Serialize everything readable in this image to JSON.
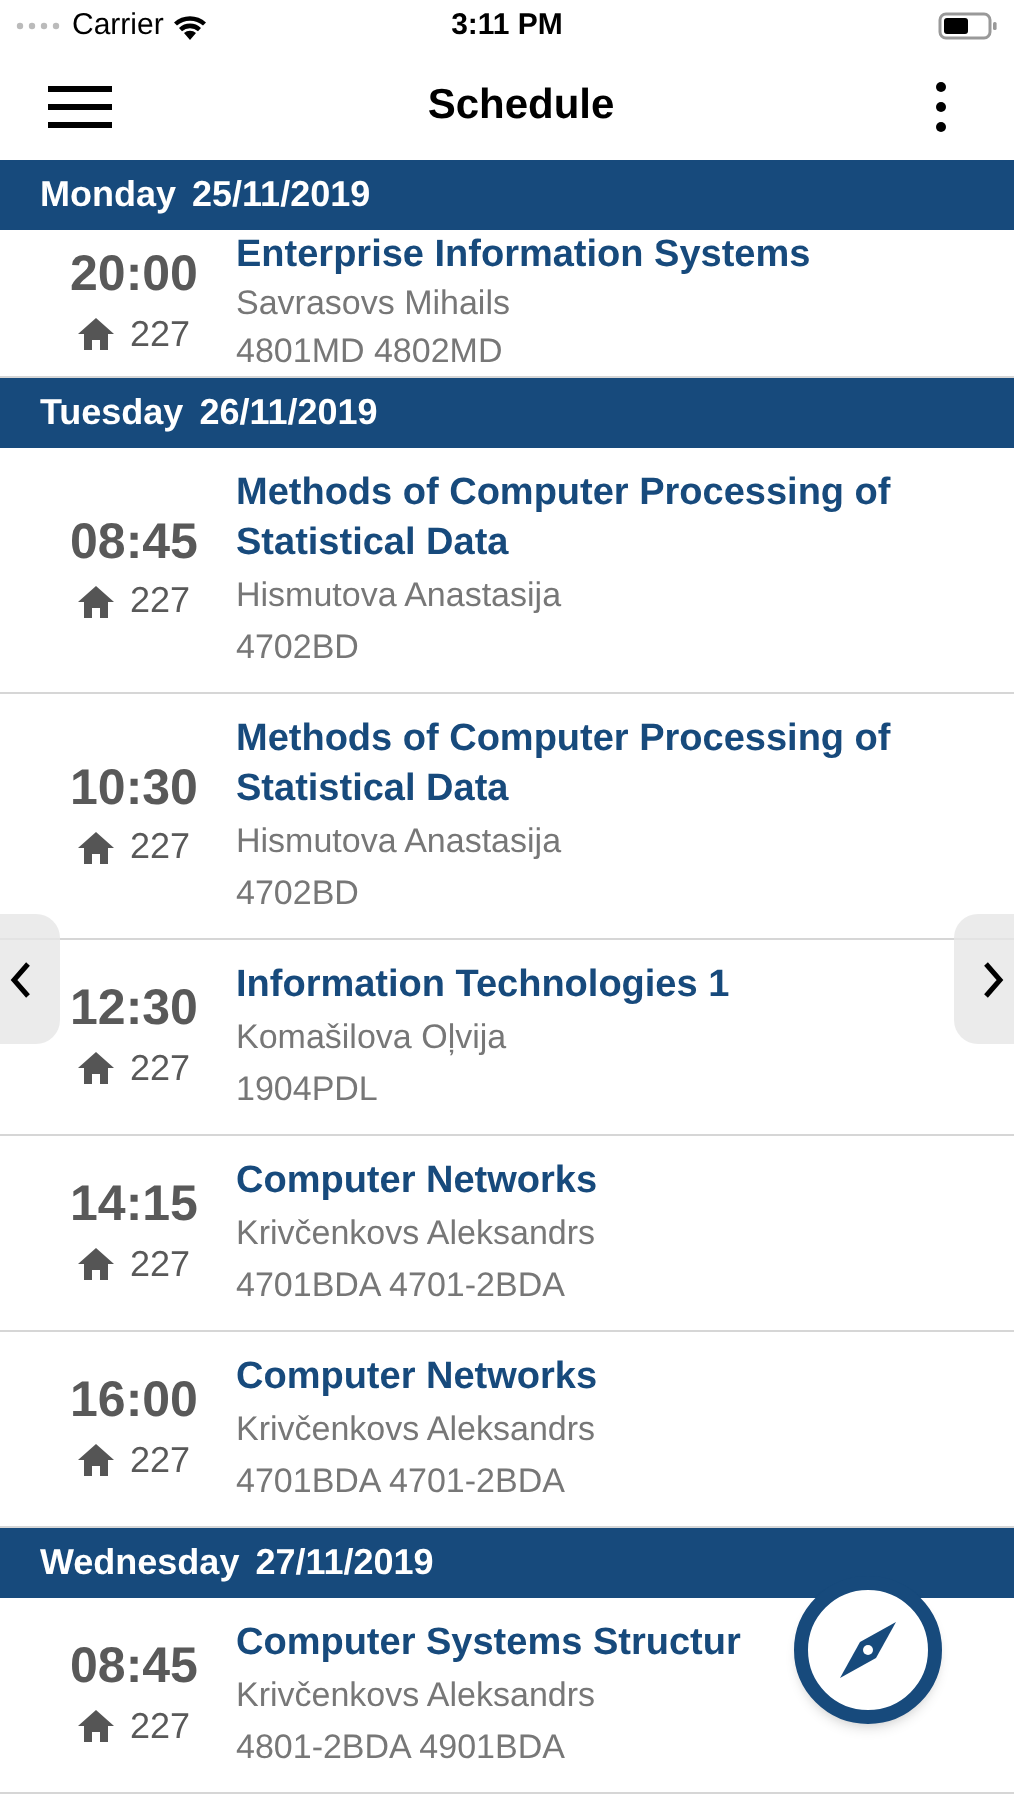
{
  "status_bar": {
    "carrier": "Carrier",
    "time": "3:11 PM"
  },
  "nav": {
    "title": "Schedule"
  },
  "sections": [
    {
      "day": "Monday",
      "date": "25/11/2019",
      "lessons": [
        {
          "time": "20:00",
          "room": "227",
          "title": "Enterprise Information Systems",
          "teacher": "Savrasovs Mihails",
          "groups": "4801MD 4802MD"
        }
      ]
    },
    {
      "day": "Tuesday",
      "date": "26/11/2019",
      "lessons": [
        {
          "time": "08:45",
          "room": "227",
          "title": "Methods of Computer Processing of Statistical Data",
          "teacher": "Hismutova Anastasija",
          "groups": "4702BD"
        },
        {
          "time": "10:30",
          "room": "227",
          "title": "Methods of Computer Processing of Statistical Data",
          "teacher": "Hismutova Anastasija",
          "groups": "4702BD"
        },
        {
          "time": "12:30",
          "room": "227",
          "title": "Information Technologies 1",
          "teacher": "Komašilova Oļvija",
          "groups": "1904PDL"
        },
        {
          "time": "14:15",
          "room": "227",
          "title": "Computer Networks",
          "teacher": "Krivčenkovs Aleksandrs",
          "groups": "4701BDA 4701-2BDA"
        },
        {
          "time": "16:00",
          "room": "227",
          "title": "Computer Networks",
          "teacher": "Krivčenkovs Aleksandrs",
          "groups": "4701BDA 4701-2BDA"
        }
      ]
    },
    {
      "day": "Wednesday",
      "date": "27/11/2019",
      "lessons": [
        {
          "time": "08:45",
          "room": "227",
          "title": "Computer Systems Structur",
          "teacher": "Krivčenkovs Aleksandrs",
          "groups": "4801-2BDA 4901BDA"
        }
      ]
    }
  ]
}
